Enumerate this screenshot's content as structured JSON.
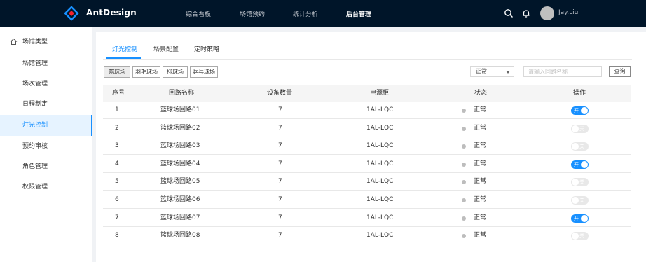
{
  "header": {
    "brand": "AntDesign",
    "nav": [
      "综合看板",
      "场馆预约",
      "统计分析",
      "后台管理"
    ],
    "active_nav": "后台管理",
    "username": "Jay.Liu",
    "icons": [
      "search-icon",
      "bell-icon"
    ]
  },
  "sidebar": {
    "items": [
      {
        "label": "场馆类型",
        "icon": "home-icon"
      },
      {
        "label": "场馆管理"
      },
      {
        "label": "场次管理"
      },
      {
        "label": "日程制定"
      },
      {
        "label": "灯光控制"
      },
      {
        "label": "预约审核"
      },
      {
        "label": "角色管理"
      },
      {
        "label": "权限管理"
      }
    ],
    "active": "灯光控制"
  },
  "tabs": [
    "灯光控制",
    "场景配置",
    "定时策略"
  ],
  "active_tab": "灯光控制",
  "filters": [
    "篮球场",
    "羽毛球场",
    "排球场",
    "乒乓球场"
  ],
  "active_filter": "篮球场",
  "status_select": "正常",
  "search": {
    "placeholder": "请输入回路名称",
    "value": ""
  },
  "query_button": "查询",
  "table": {
    "headers": [
      "序号",
      "回路名称",
      "设备数量",
      "电源柜",
      "状态",
      "操作"
    ],
    "rows": [
      {
        "no": "1",
        "name": "篮球场回路01",
        "count": "7",
        "cabinet": "1AL-LQC",
        "status": "正常",
        "switch": "开",
        "on": true
      },
      {
        "no": "2",
        "name": "篮球场回路02",
        "count": "7",
        "cabinet": "1AL-LQC",
        "status": "正常",
        "switch": "关",
        "on": false
      },
      {
        "no": "3",
        "name": "篮球场回路03",
        "count": "7",
        "cabinet": "1AL-LQC",
        "status": "正常",
        "switch": "关",
        "on": false
      },
      {
        "no": "4",
        "name": "篮球场回路04",
        "count": "7",
        "cabinet": "1AL-LQC",
        "status": "正常",
        "switch": "开",
        "on": true
      },
      {
        "no": "5",
        "name": "篮球场回路05",
        "count": "7",
        "cabinet": "1AL-LQC",
        "status": "正常",
        "switch": "关",
        "on": false
      },
      {
        "no": "6",
        "name": "篮球场回路06",
        "count": "7",
        "cabinet": "1AL-LQC",
        "status": "正常",
        "switch": "关",
        "on": false
      },
      {
        "no": "7",
        "name": "篮球场回路07",
        "count": "7",
        "cabinet": "1AL-LQC",
        "status": "正常",
        "switch": "开",
        "on": true
      },
      {
        "no": "8",
        "name": "篮球场回路08",
        "count": "7",
        "cabinet": "1AL-LQC",
        "status": "正常",
        "switch": "关",
        "on": false
      }
    ]
  },
  "colors": {
    "header_bg": "#001529",
    "accent": "#1890ff",
    "switch_off": "#e8e8e8",
    "status_dot": "#bdbdbd"
  }
}
